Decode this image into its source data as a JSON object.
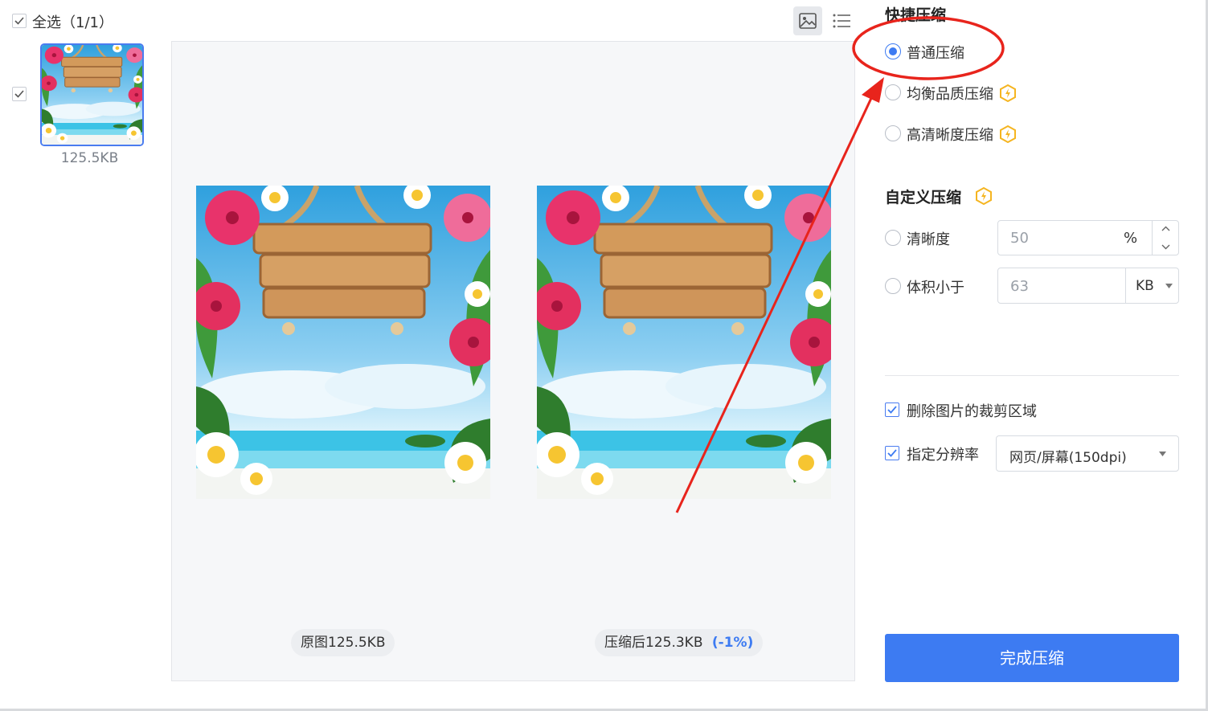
{
  "left_panel": {
    "select_all_label": "全选（1/1）",
    "thumb_size": "125.5KB"
  },
  "preview": {
    "original_label": "原图125.5KB",
    "compressed_label": "压缩后125.3KB",
    "compressed_change": "(-1%)",
    "view_icons": [
      "image-view-icon",
      "list-view-icon"
    ]
  },
  "quick": {
    "title": "快捷压缩",
    "options": [
      {
        "label": "普通压缩",
        "selected": true,
        "vip": false
      },
      {
        "label": "均衡品质压缩",
        "selected": false,
        "vip": true
      },
      {
        "label": "高清晰度压缩",
        "selected": false,
        "vip": true
      }
    ]
  },
  "custom": {
    "title": "自定义压缩",
    "clarity_label": "清晰度",
    "clarity_value": "50",
    "clarity_unit": "%",
    "size_label": "体积小于",
    "size_value": "63",
    "size_unit": "KB"
  },
  "options": {
    "remove_crop_label": "删除图片的裁剪区域",
    "set_dpi_label": "指定分辨率",
    "dpi_value": "网页/屏幕(150dpi)"
  },
  "finish_button": "完成压缩",
  "colors": {
    "accent": "#3d7bf2",
    "annotation": "#e8241c",
    "vip": "#f5b521"
  }
}
